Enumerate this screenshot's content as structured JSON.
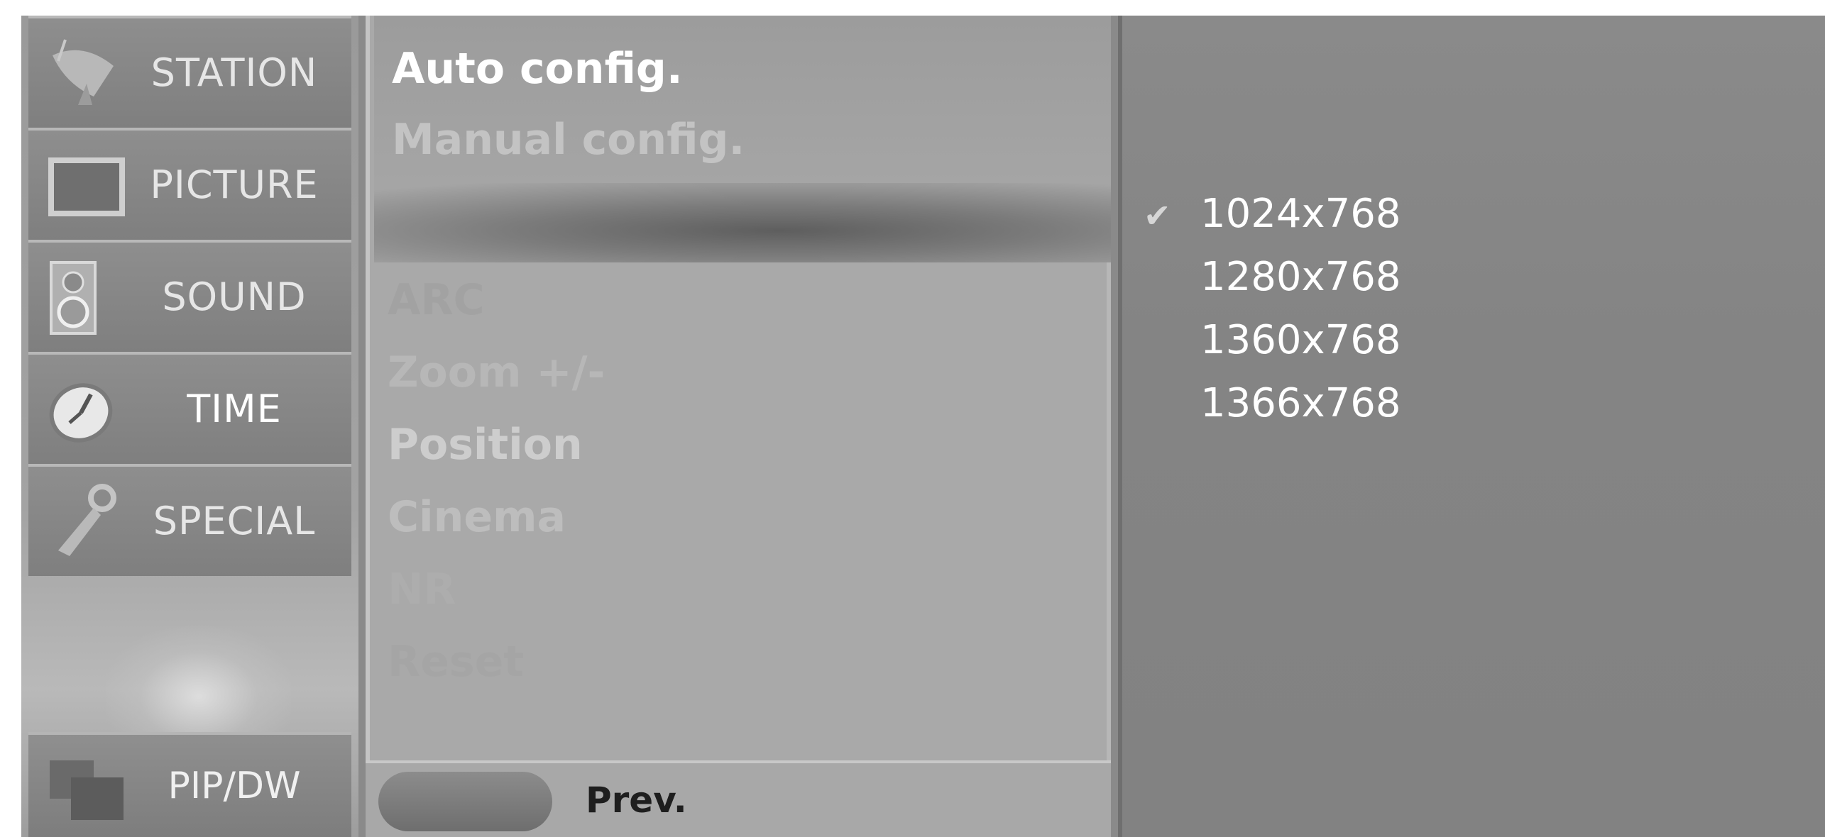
{
  "left_menu": {
    "items": [
      {
        "label": "STATION",
        "icon": "satellite-dish-icon"
      },
      {
        "label": "PICTURE",
        "icon": "tv-screen-icon"
      },
      {
        "label": "SOUND",
        "icon": "speaker-icon"
      },
      {
        "label": "TIME",
        "icon": "clock-icon",
        "selected": true
      },
      {
        "label": "SPECIAL",
        "icon": "key-icon"
      }
    ],
    "pip_label": "PIP/DW",
    "pip_icon": "pip-windows-icon"
  },
  "submenu": {
    "config_items": [
      {
        "label": "Auto config.",
        "active": true
      },
      {
        "label": "Manual config.",
        "active": false
      }
    ],
    "dimmed_items": [
      "ARC",
      "Zoom +/-",
      "Position",
      "Cinema",
      "NR",
      "Reset"
    ],
    "prev_label": "Prev."
  },
  "resolution_panel": {
    "options": [
      "1024x768",
      "1280x768",
      "1360x768",
      "1366x768"
    ],
    "selected": "1024x768",
    "check_glyph": "✔"
  },
  "colors": {
    "panel_bg": "#8a8a8a",
    "text_active": "#ffffff",
    "text_dim": "#b9b9b9"
  }
}
